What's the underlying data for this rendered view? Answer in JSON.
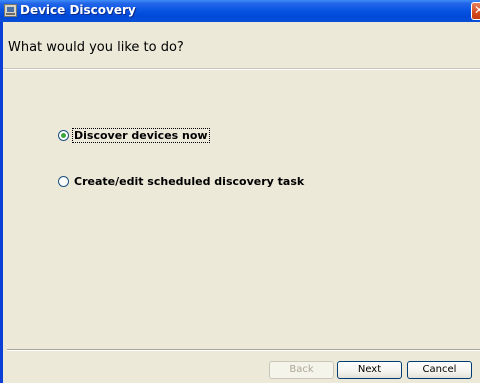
{
  "window": {
    "title": "Device Discovery",
    "close_glyph": "✕"
  },
  "header": {
    "title": "What would you like to do?"
  },
  "options": [
    {
      "label": "Discover devices now",
      "selected": true
    },
    {
      "label": "Create/edit scheduled discovery task",
      "selected": false
    }
  ],
  "buttons": {
    "back": {
      "label": "Back",
      "enabled": false
    },
    "next": {
      "label": "Next",
      "enabled": true
    },
    "cancel": {
      "label": "Cancel",
      "enabled": true
    }
  },
  "icons": {
    "app": "app-window-icon",
    "close": "close-icon"
  },
  "colors": {
    "titlebar": "#0a55e3",
    "client_bg": "#ece9d8",
    "radio_selected": "#3da63d",
    "close_button": "#d44a1f"
  }
}
